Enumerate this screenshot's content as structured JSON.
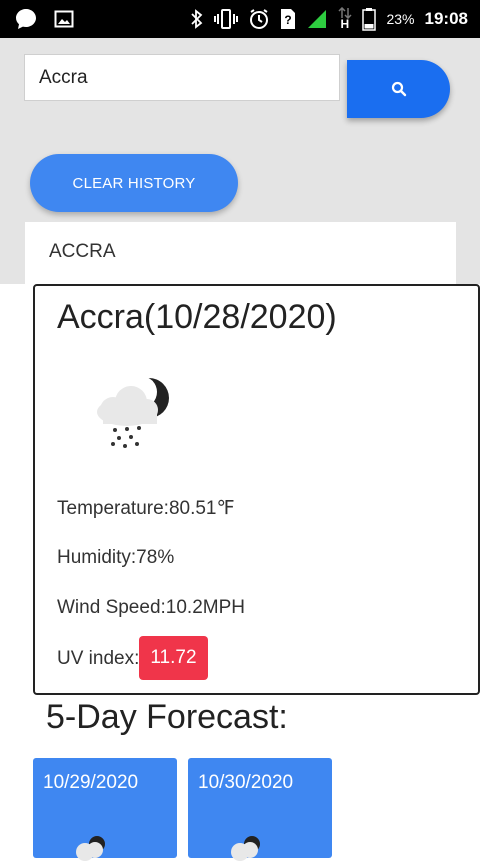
{
  "status_bar": {
    "battery": "23%",
    "time": "19:08",
    "network_type": "H"
  },
  "search": {
    "value": "Accra",
    "button_icon": "search-icon"
  },
  "history": {
    "clear_label": "CLEAR HISTORY",
    "items": [
      "ACCRA"
    ]
  },
  "current": {
    "title": "Accra(10/28/2020)",
    "icon": "night-rain-icon",
    "temperature": "Temperature:80.51℉",
    "humidity": "Humidity:78%",
    "wind": "Wind Speed:10.2MPH",
    "uv_label": "UV index:",
    "uv_value": "11.72",
    "uv_color": "#f0354a"
  },
  "forecast": {
    "heading": "5-Day Forecast:",
    "cards": [
      {
        "date": "10/29/2020",
        "icon": "night-rain-icon"
      },
      {
        "date": "10/30/2020",
        "icon": "night-rain-icon"
      }
    ]
  },
  "colors": {
    "primary_button": "#1a6ef0",
    "forecast_card": "#3f87f1"
  }
}
